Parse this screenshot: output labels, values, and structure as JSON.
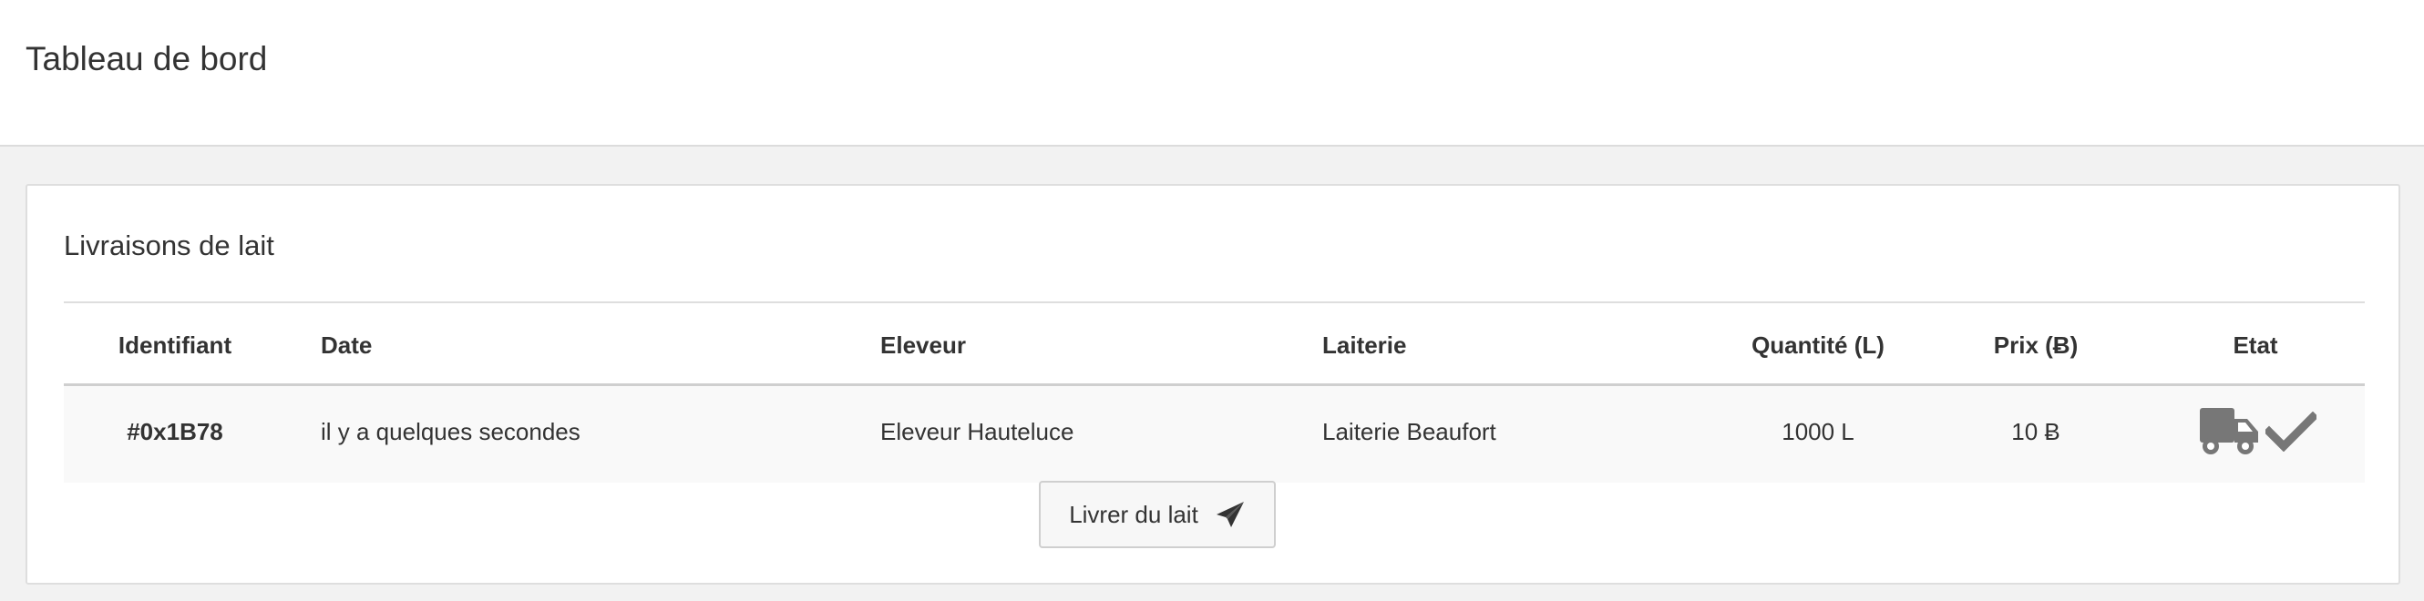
{
  "page": {
    "title": "Tableau de bord"
  },
  "card": {
    "title": "Livraisons de lait"
  },
  "table": {
    "headers": {
      "id": "Identifiant",
      "date": "Date",
      "eleveur": "Eleveur",
      "laiterie": "Laiterie",
      "quantite": "Quantité (L)",
      "prix": "Prix (Ƀ)",
      "etat": "Etat"
    },
    "rows": [
      {
        "id": "#0x1B78",
        "date": "il y a quelques secondes",
        "eleveur": "Eleveur Hauteluce",
        "laiterie": "Laiterie Beaufort",
        "quantite": "1000 L",
        "prix": "10 Ƀ",
        "etat_icons": [
          "truck-icon",
          "check-icon"
        ]
      }
    ]
  },
  "actions": {
    "deliver_label": "Livrer du lait",
    "deliver_icon": "paper-plane-icon"
  },
  "colors": {
    "icon": "#777777",
    "row_bg": "#f9f9f9",
    "page_bg": "#f2f2f2"
  }
}
